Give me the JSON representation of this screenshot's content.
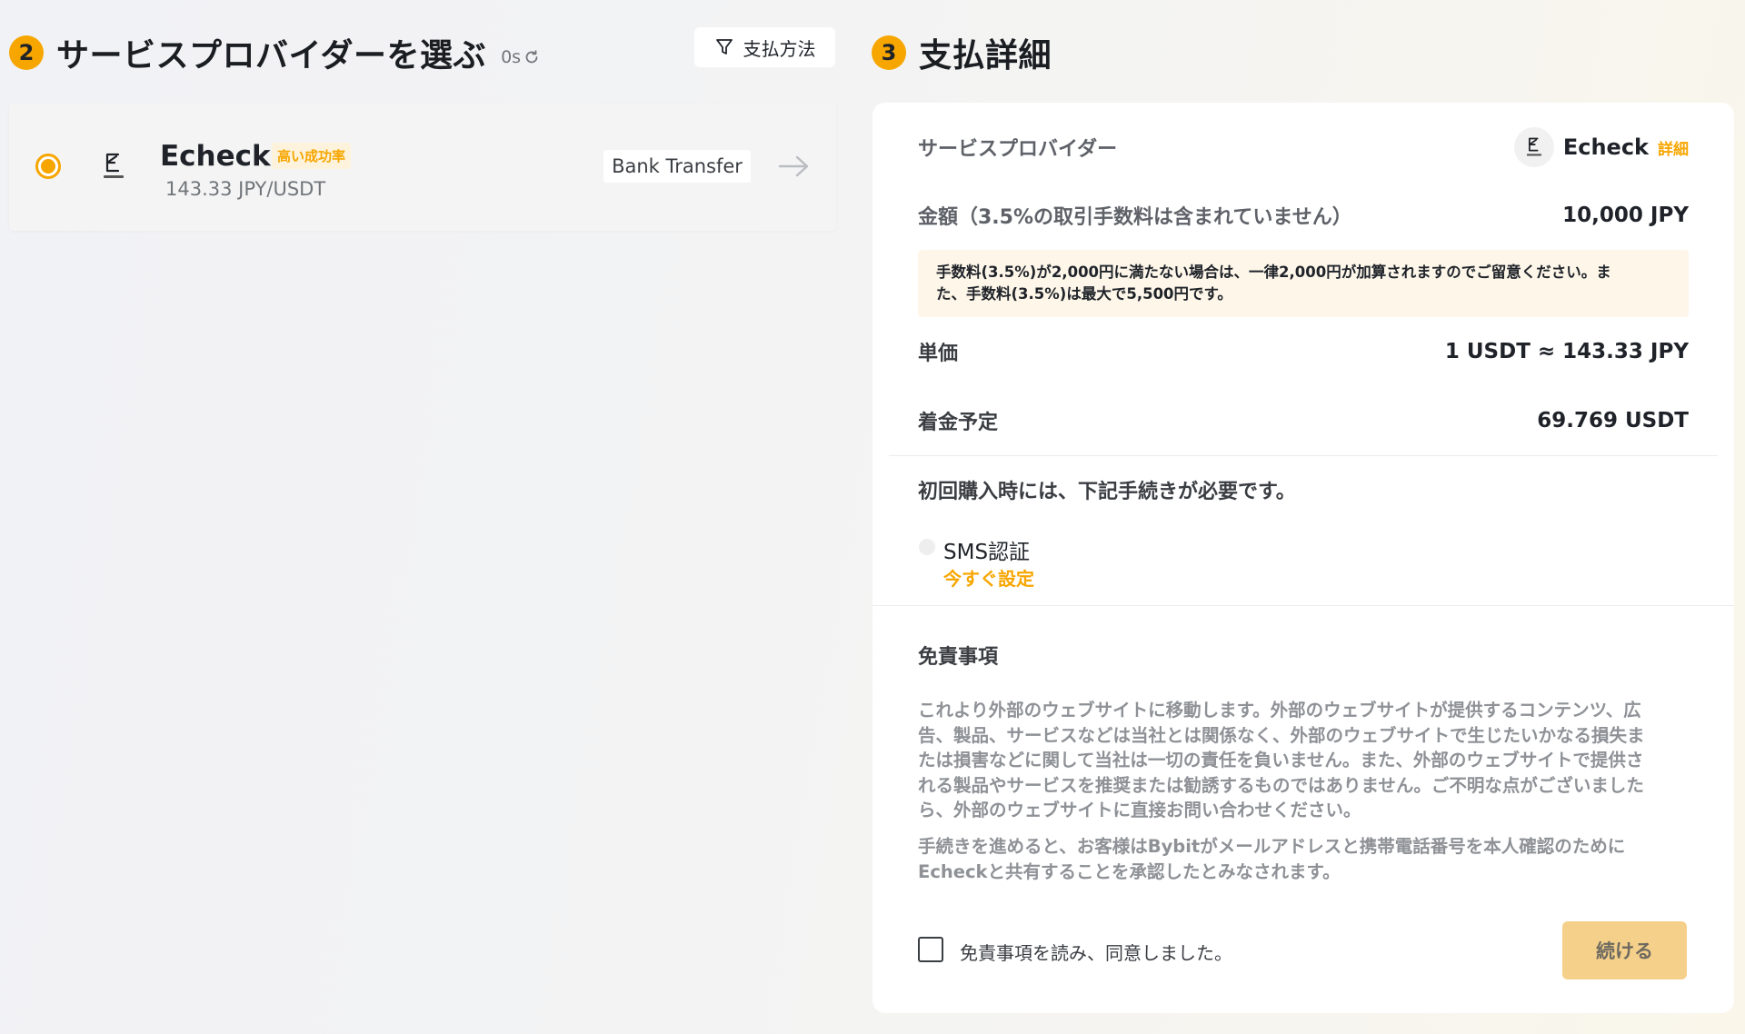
{
  "colors": {
    "accent": "#f7a600",
    "button_disabled": "#f5d08a",
    "notice_bg": "#fdf6e9"
  },
  "step2": {
    "number": "2",
    "title": "サービスプロバイダーを選ぶ",
    "timer": "0s",
    "filter_label": "支払方法"
  },
  "provider": {
    "name": "Echeck",
    "badge": "高い成功率",
    "rate": "143.33 JPY/USDT",
    "method": "Bank Transfer",
    "selected": true
  },
  "step3": {
    "number": "3",
    "title": "支払詳細"
  },
  "details": {
    "provider_label": "サービスプロバイダー",
    "provider_name": "Echeck",
    "detail_link": "詳細",
    "amount_label": "金額（3.5%の取引手数料は含まれていません）",
    "amount_value": "10,000 JPY",
    "notice_line1": "手数料(3.5%)が2,000円に満たない場合は、一律2,000円が加算されますのでご留意ください。ま",
    "notice_line2": "た、手数料(3.5%)は最大で5,500円です。",
    "unit_price_label": "単価",
    "unit_price_value": "1 USDT ≈ 143.33 JPY",
    "expected_label": "着金予定",
    "expected_value": "69.769 USDT",
    "requirement_title": "初回購入時には、下記手続きが必要です。",
    "sms_label": "SMS認証",
    "sms_link": "今すぐ設定",
    "disclaimer_title": "免責事項",
    "disclaimer_lines": [
      "これより外部のウェブサイトに移動します。外部のウェブサイトが提供するコンテンツ、広",
      "告、製品、サービスなどは当社とは関係なく、外部のウェブサイトで生じたいかなる損失ま",
      "たは損害などに関して当社は一切の責任を負いません。また、外部のウェブサイトで提供さ",
      "れる製品やサービスを推奨または勧誘するものではありません。ご不明な点がございました",
      "ら、外部のウェブサイトに直接お問い合わせください。"
    ],
    "consent_lines": [
      "手続きを進めると、お客様はBybitがメールアドレスと携帯電話番号を本人確認のために",
      "Echeckと共有することを承認したとみなされます。"
    ],
    "agree_label": "免責事項を読み、同意しました。",
    "continue_label": "続ける"
  }
}
